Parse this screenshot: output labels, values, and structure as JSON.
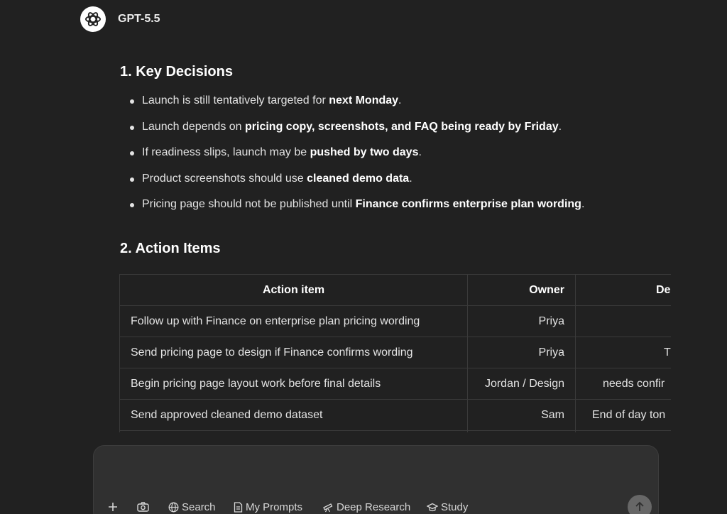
{
  "header": {
    "model_name": "GPT-5.5",
    "logo_icon": "openai-logo-icon"
  },
  "decisions": {
    "heading": "1. Key Decisions",
    "items": [
      {
        "pre": "Launch is still tentatively targeted for ",
        "bold": "next Monday",
        "post": "."
      },
      {
        "pre": "Launch depends on ",
        "bold": "pricing copy, screenshots, and FAQ being ready by Friday",
        "post": "."
      },
      {
        "pre": "If readiness slips, launch may be ",
        "bold": "pushed by two days",
        "post": "."
      },
      {
        "pre": "Product screenshots should use ",
        "bold": "cleaned demo data",
        "post": "."
      },
      {
        "pre": "Pricing page should not be published until ",
        "bold": "Finance confirms enterprise plan wording",
        "post": "."
      }
    ]
  },
  "actions": {
    "heading": "2. Action Items",
    "columns": [
      "Action item",
      "Owner",
      "De"
    ],
    "rows": [
      [
        "Follow up with Finance on enterprise plan pricing wording",
        "Priya",
        ""
      ],
      [
        "Send pricing page to design if Finance confirms wording",
        "Priya",
        "Th"
      ],
      [
        "Begin pricing page layout work before final details",
        "Jordan / Design",
        "needs confir"
      ],
      [
        "Send approved cleaned demo dataset",
        "Sam",
        "End of day ton"
      ]
    ]
  },
  "composer": {
    "tools": [
      {
        "label": "",
        "icon": "plus-icon"
      },
      {
        "label": "",
        "icon": "camera-icon"
      },
      {
        "label": "Search",
        "icon": "globe-icon"
      },
      {
        "label": "My Prompts",
        "icon": "document-icon"
      },
      {
        "label": "Deep Research",
        "icon": "telescope-icon"
      },
      {
        "label": "Study",
        "icon": "graduation-cap-icon"
      }
    ],
    "send_icon": "arrow-up-icon"
  }
}
